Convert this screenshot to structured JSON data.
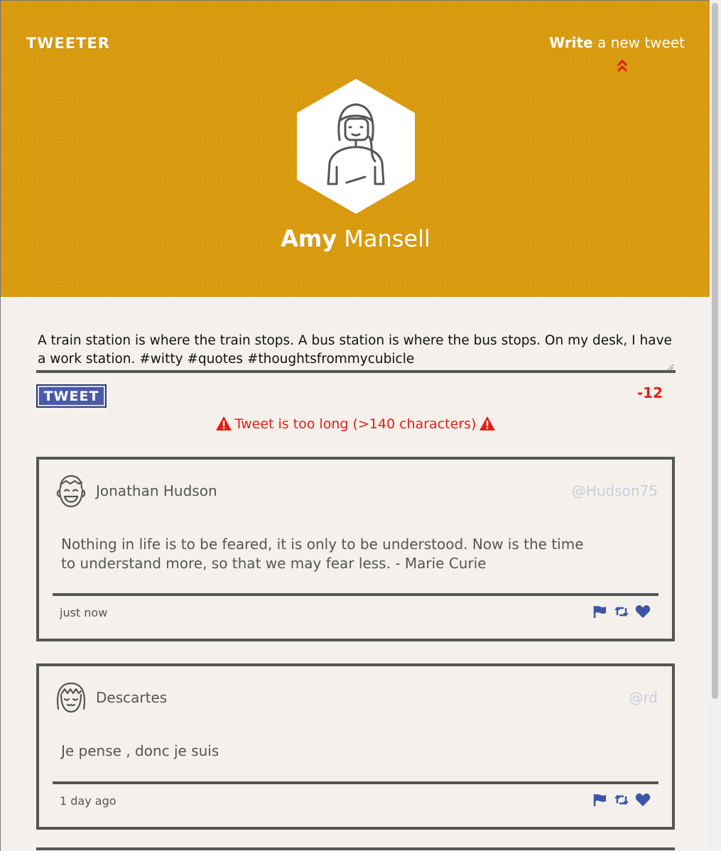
{
  "header": {
    "logo": "TWEETER",
    "compose_toggle": {
      "bold": "Write",
      "rest": " a new tweet"
    },
    "user": {
      "first_name": "Amy",
      "last_name": "Mansell"
    },
    "colors": {
      "background": "#d89a0f",
      "accent_red": "#e41e14"
    }
  },
  "composer": {
    "text": "A train station is where the train stops. A bus station is where the bus stops. On my desk, I have a work station. #witty #quotes #thoughtsfrommycubicle",
    "button_label": "TWEET",
    "counter": "-12",
    "error": "Tweet is too long (>140 characters)",
    "colors": {
      "button": "#4a5aa8",
      "error": "#e41e14"
    }
  },
  "tweets": [
    {
      "name": "Jonathan Hudson",
      "handle": "@Hudson75",
      "text": "Nothing in life is to be feared, it is only to be understood. Now is the time to understand more, so that we may fear less. - Marie Curie",
      "time": "just now",
      "avatar_icon": "smiling-boy-icon"
    },
    {
      "name": "Descartes",
      "handle": "@rd",
      "text": "Je pense , donc je suis",
      "time": "1 day ago",
      "avatar_icon": "girl-face-icon"
    }
  ],
  "icons": {
    "actions": [
      "flag-icon",
      "retweet-icon",
      "heart-icon"
    ],
    "action_color": "#3d55a8"
  }
}
